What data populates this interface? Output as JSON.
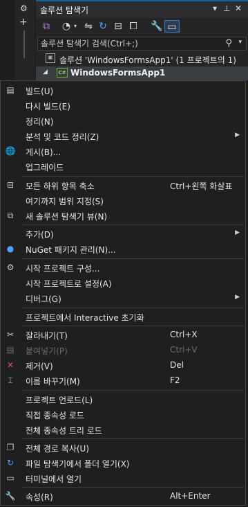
{
  "panel": {
    "title": "솔루션 탐색기",
    "title_buttons": [
      "▾",
      "⊥",
      "✕"
    ],
    "search_placeholder": "솔루션 탐색기 검색(Ctrl+;)",
    "solution_label": "솔루션 'WindowsFormsApp1' (1 프로젝트의 1)",
    "project_label": "WindowsFormsApp1",
    "project_badge": "C#"
  },
  "menu": {
    "items": [
      {
        "label": "빌드(U)",
        "icon": "build-icon"
      },
      {
        "label": "다시 빌드(E)"
      },
      {
        "label": "정리(N)"
      },
      {
        "label": "분석 및 코드 정리(Z)",
        "submenu": true
      },
      {
        "label": "게시(B)...",
        "icon": "globe-icon"
      },
      {
        "label": "업그레이드"
      },
      {
        "label": "모든 하위 항목 축소",
        "shortcut": "Ctrl+왼쪽 화살표",
        "icon": "collapse-icon"
      },
      {
        "label": "여기까지 범위 지정(S)"
      },
      {
        "label": "새 솔루션 탐색기 뷰(N)",
        "icon": "new-view-icon"
      },
      {
        "label": "추가(D)",
        "submenu": true
      },
      {
        "label": "NuGet 패키지 관리(N)...",
        "icon": "nuget-icon"
      },
      {
        "label": "시작 프로젝트 구성...",
        "icon": "gear-icon"
      },
      {
        "label": "시작 프로젝트로 설정(A)"
      },
      {
        "label": "디버그(G)",
        "submenu": true
      },
      {
        "label": "프로젝트에서 Interactive 초기화"
      },
      {
        "label": "잘라내기(T)",
        "shortcut": "Ctrl+X",
        "icon": "scissors-icon"
      },
      {
        "label": "붙여넣기(P)",
        "shortcut": "Ctrl+V",
        "icon": "paste-icon",
        "disabled": true
      },
      {
        "label": "제거(V)",
        "shortcut": "Del",
        "icon": "delete-icon"
      },
      {
        "label": "이름 바꾸기(M)",
        "shortcut": "F2",
        "icon": "rename-icon"
      },
      {
        "label": "프로젝트 언로드(L)"
      },
      {
        "label": "직접 종속성 로드"
      },
      {
        "label": "전체 종속성 트리 로드"
      },
      {
        "label": "전체 경로 복사(U)",
        "icon": "copy-icon"
      },
      {
        "label": "파일 탐색기에서 폴더 열기(X)",
        "icon": "folder-refresh-icon"
      },
      {
        "label": "터미널에서 열기",
        "icon": "terminal-icon"
      },
      {
        "label": "속성(R)",
        "shortcut": "Alt+Enter",
        "icon": "wrench-icon"
      }
    ]
  },
  "colors": {
    "accent": "#0e639c",
    "menu_bg": "#1f1f1f",
    "text": "#e6e6e6",
    "disabled_text": "#6d6d6d",
    "delete_icon": "#e05555"
  }
}
